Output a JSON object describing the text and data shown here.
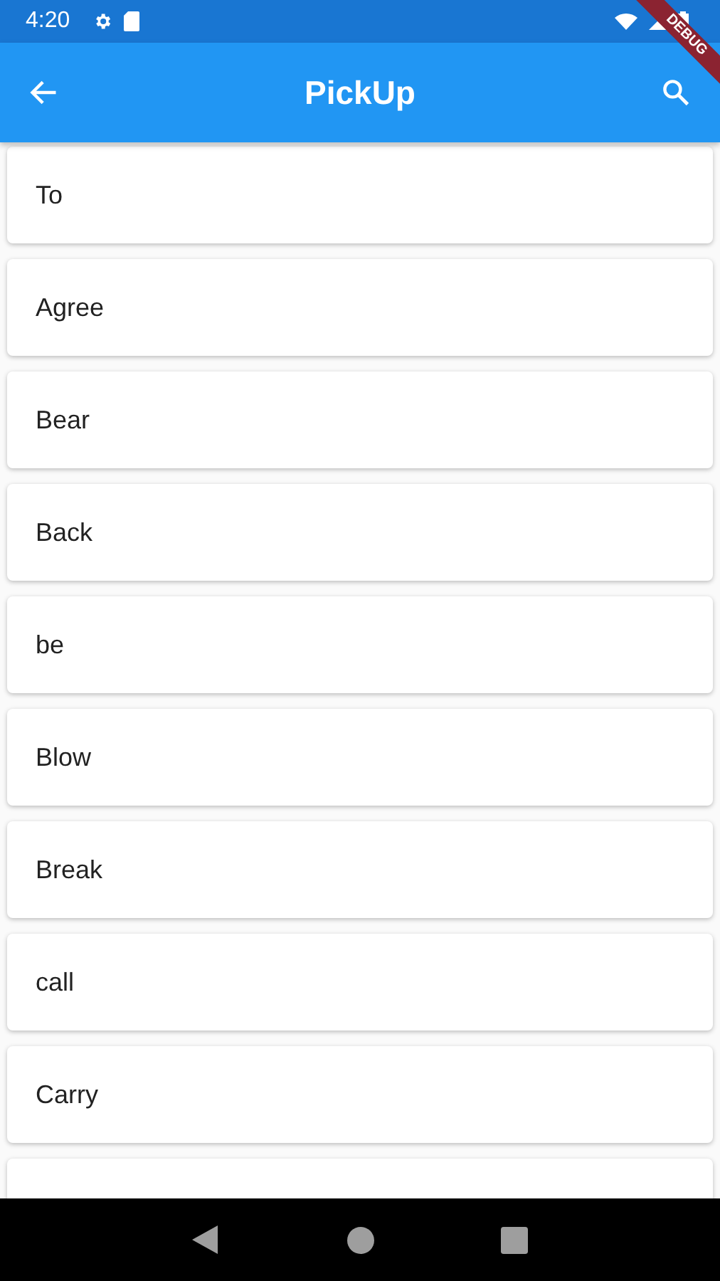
{
  "status_bar": {
    "time": "4:20"
  },
  "debug_banner": {
    "label": "DEBUG"
  },
  "app_bar": {
    "title": "PickUp"
  },
  "items": [
    {
      "label": "To"
    },
    {
      "label": "Agree"
    },
    {
      "label": "Bear"
    },
    {
      "label": "Back"
    },
    {
      "label": "be"
    },
    {
      "label": "Blow"
    },
    {
      "label": "Break"
    },
    {
      "label": "call"
    },
    {
      "label": "Carry"
    }
  ]
}
